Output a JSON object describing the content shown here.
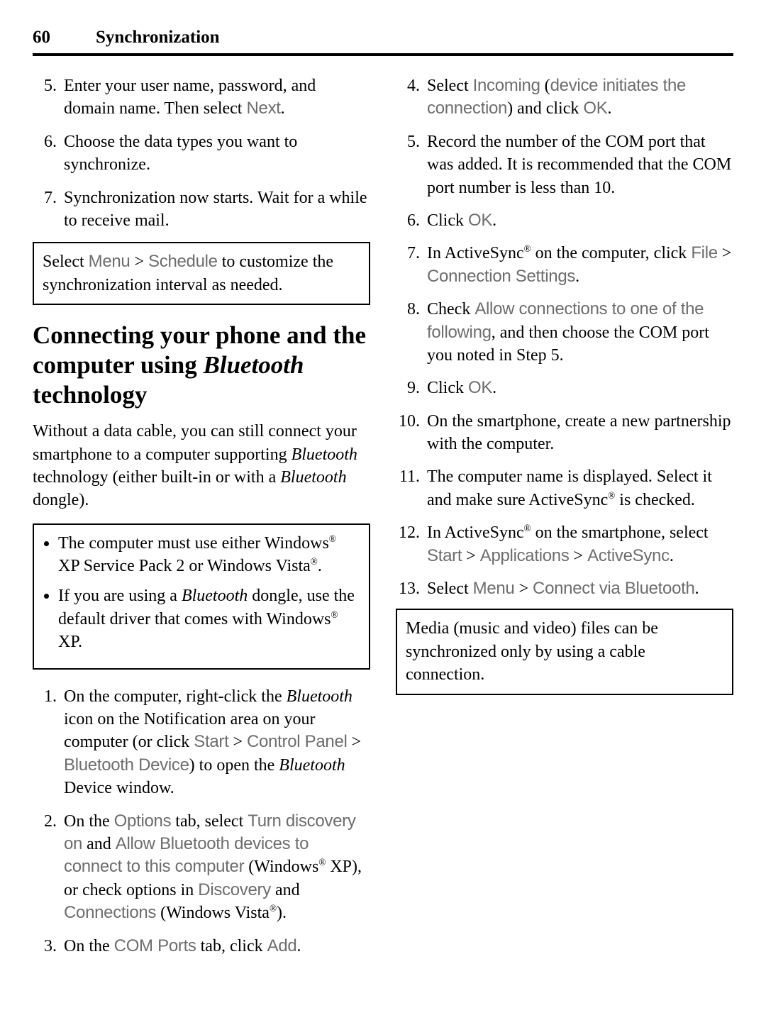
{
  "header": {
    "page_number": "60",
    "title": "Synchronization"
  },
  "col1": {
    "steps_a": {
      "s5_a": "Enter your user name, password, and domain name. Then select ",
      "s5_ui": "Next",
      "s5_b": ".",
      "s6": "Choose the data types you want to synchronize.",
      "s7": "Synchronization now starts. Wait for a while to receive mail."
    },
    "note1": {
      "a": "Select ",
      "ui1": "Menu",
      "b": " > ",
      "ui2": "Schedule",
      "c": " to customize the synchronization interval as needed."
    },
    "heading": {
      "a": "Connecting your phone and the computer using ",
      "bt": "Bluetooth",
      "b": " technology"
    },
    "intro": {
      "a": "Without a data cable, you can still connect your smartphone to a computer supporting ",
      "bt": "Bluetooth",
      "b": " technology (either built-in or with a ",
      "bt2": "Bluetooth",
      "c": " dongle)."
    },
    "note2": {
      "li1": {
        "a": "The computer must use either Windows",
        "r1": "®",
        "b": " XP Service Pack 2 or Windows Vista",
        "r2": "®",
        "c": "."
      },
      "li2": {
        "a": "If you are using a ",
        "bt": "Bluetooth",
        "b": " dongle, use the default driver that comes with Windows",
        "r": "®",
        "c": " XP."
      }
    },
    "steps_b": {
      "s1": {
        "a": "On the computer, right-click the ",
        "bt": "Bluetooth",
        "b": " icon on the Notification area on your computer (or click ",
        "ui1": "Start",
        "c": " > ",
        "ui2": "Control Panel",
        "d": " > ",
        "ui3": "Bluetooth Device",
        "e": ") to open the ",
        "bt2": "Bluetooth",
        "f": " Device window."
      },
      "s2": {
        "a": "On the ",
        "ui1": "Options",
        "b": " tab, select ",
        "ui2": "Turn discovery on",
        "c": " and ",
        "ui3": "Allow Bluetooth devices to connect to this computer",
        "d": " (Windows",
        "r1": "®",
        "e": " XP), or check options in ",
        "ui4": "Discovery",
        "f": " and ",
        "ui5": "Connections",
        "g": " (Windows Vista",
        "r2": "®",
        "h": ")."
      }
    }
  },
  "col2": {
    "steps": {
      "s3": {
        "a": "On the ",
        "ui1": "COM Ports",
        "b": " tab, click ",
        "ui2": "Add",
        "c": "."
      },
      "s4": {
        "a": "Select ",
        "ui1": "Incoming",
        "b": " (",
        "ui2": "device initiates the connection",
        "c": ") and click ",
        "ui3": "OK",
        "d": "."
      },
      "s5": "Record the number of the COM port that was added. It is recommended that the COM port number is less than 10.",
      "s6": {
        "a": "Click ",
        "ui": "OK",
        "b": "."
      },
      "s7": {
        "a": "In ActiveSync",
        "r": "®",
        "b": " on the computer, click ",
        "ui1": "File",
        "c": " > ",
        "ui2": "Connection Settings",
        "d": "."
      },
      "s8": {
        "a": "Check ",
        "ui": "Allow connections to one of the following",
        "b": ", and then choose the COM port you noted in Step 5."
      },
      "s9": {
        "a": "Click ",
        "ui": "OK",
        "b": "."
      },
      "s10": "On the smartphone, create a new partnership with the computer.",
      "s11": {
        "a": "The computer name is displayed. Select it and make sure ActiveSync",
        "r": "®",
        "b": " is checked."
      },
      "s12": {
        "a": "In ActiveSync",
        "r": "®",
        "b": " on the smartphone, select ",
        "ui1": "Start",
        "c": " > ",
        "ui2": "Applications",
        "d": " > ",
        "ui3": "ActiveSync",
        "e": "."
      },
      "s13": {
        "a": "Select ",
        "ui1": "Menu",
        "b": " > ",
        "ui2": "Connect via Bluetooth",
        "c": "."
      }
    },
    "note": "Media (music and video) files can be synchronized only by using a cable connection."
  }
}
